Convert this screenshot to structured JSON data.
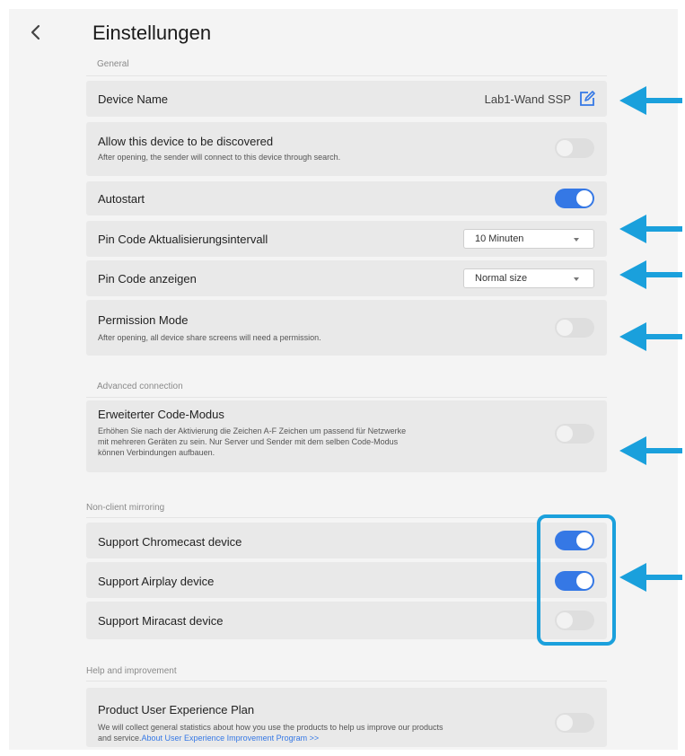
{
  "header": {
    "title": "Einstellungen",
    "back_icon": "chevron-left-icon"
  },
  "sections": {
    "general": "General",
    "advanced": "Advanced connection",
    "mirroring": "Non-client mirroring",
    "help": "Help and improvement"
  },
  "device_name": {
    "label": "Device Name",
    "value": "Lab1-Wand SSP",
    "icon": "edit-icon"
  },
  "discover": {
    "label": "Allow this device to be discovered",
    "description": "After opening, the sender will connect to this device through search.",
    "enabled": false
  },
  "autostart": {
    "label": "Autostart",
    "enabled": true
  },
  "pin_interval": {
    "label": "Pin Code Aktualisierungsintervall",
    "selected": "10 Minuten"
  },
  "pin_show": {
    "label": "Pin Code anzeigen",
    "selected": "Normal size"
  },
  "permission": {
    "label": "Permission Mode",
    "description": "After opening, all device share screens will need a permission.",
    "enabled": false
  },
  "extended_code": {
    "label": "Erweiterter Code-Modus",
    "description_line1": "Erhöhen Sie nach der Aktivierung die Zeichen A-F Zeichen um passend für Netzwerke",
    "description_line2": "mit mehreren Geräten zu sein. Nur Server und Sender mit dem selben Code-Modus",
    "description_line3": "können Verbindungen aufbauen.",
    "enabled": false
  },
  "chromecast": {
    "label": "Support Chromecast device",
    "enabled": true
  },
  "airplay": {
    "label": "Support Airplay device",
    "enabled": true
  },
  "miracast": {
    "label": "Support Miracast device",
    "enabled": false
  },
  "ux_plan": {
    "label": "Product User Experience Plan",
    "description_line1": "We will collect general statistics about how you use the products to help us improve our products",
    "description_line2_prefix": "and service.",
    "link": "About User Experience Improvement Program >>",
    "enabled": false
  },
  "colors": {
    "accent": "#3578e5",
    "annotation": "#1aa0dc",
    "panel": "#f4f4f4",
    "row": "#e9e9e9"
  }
}
